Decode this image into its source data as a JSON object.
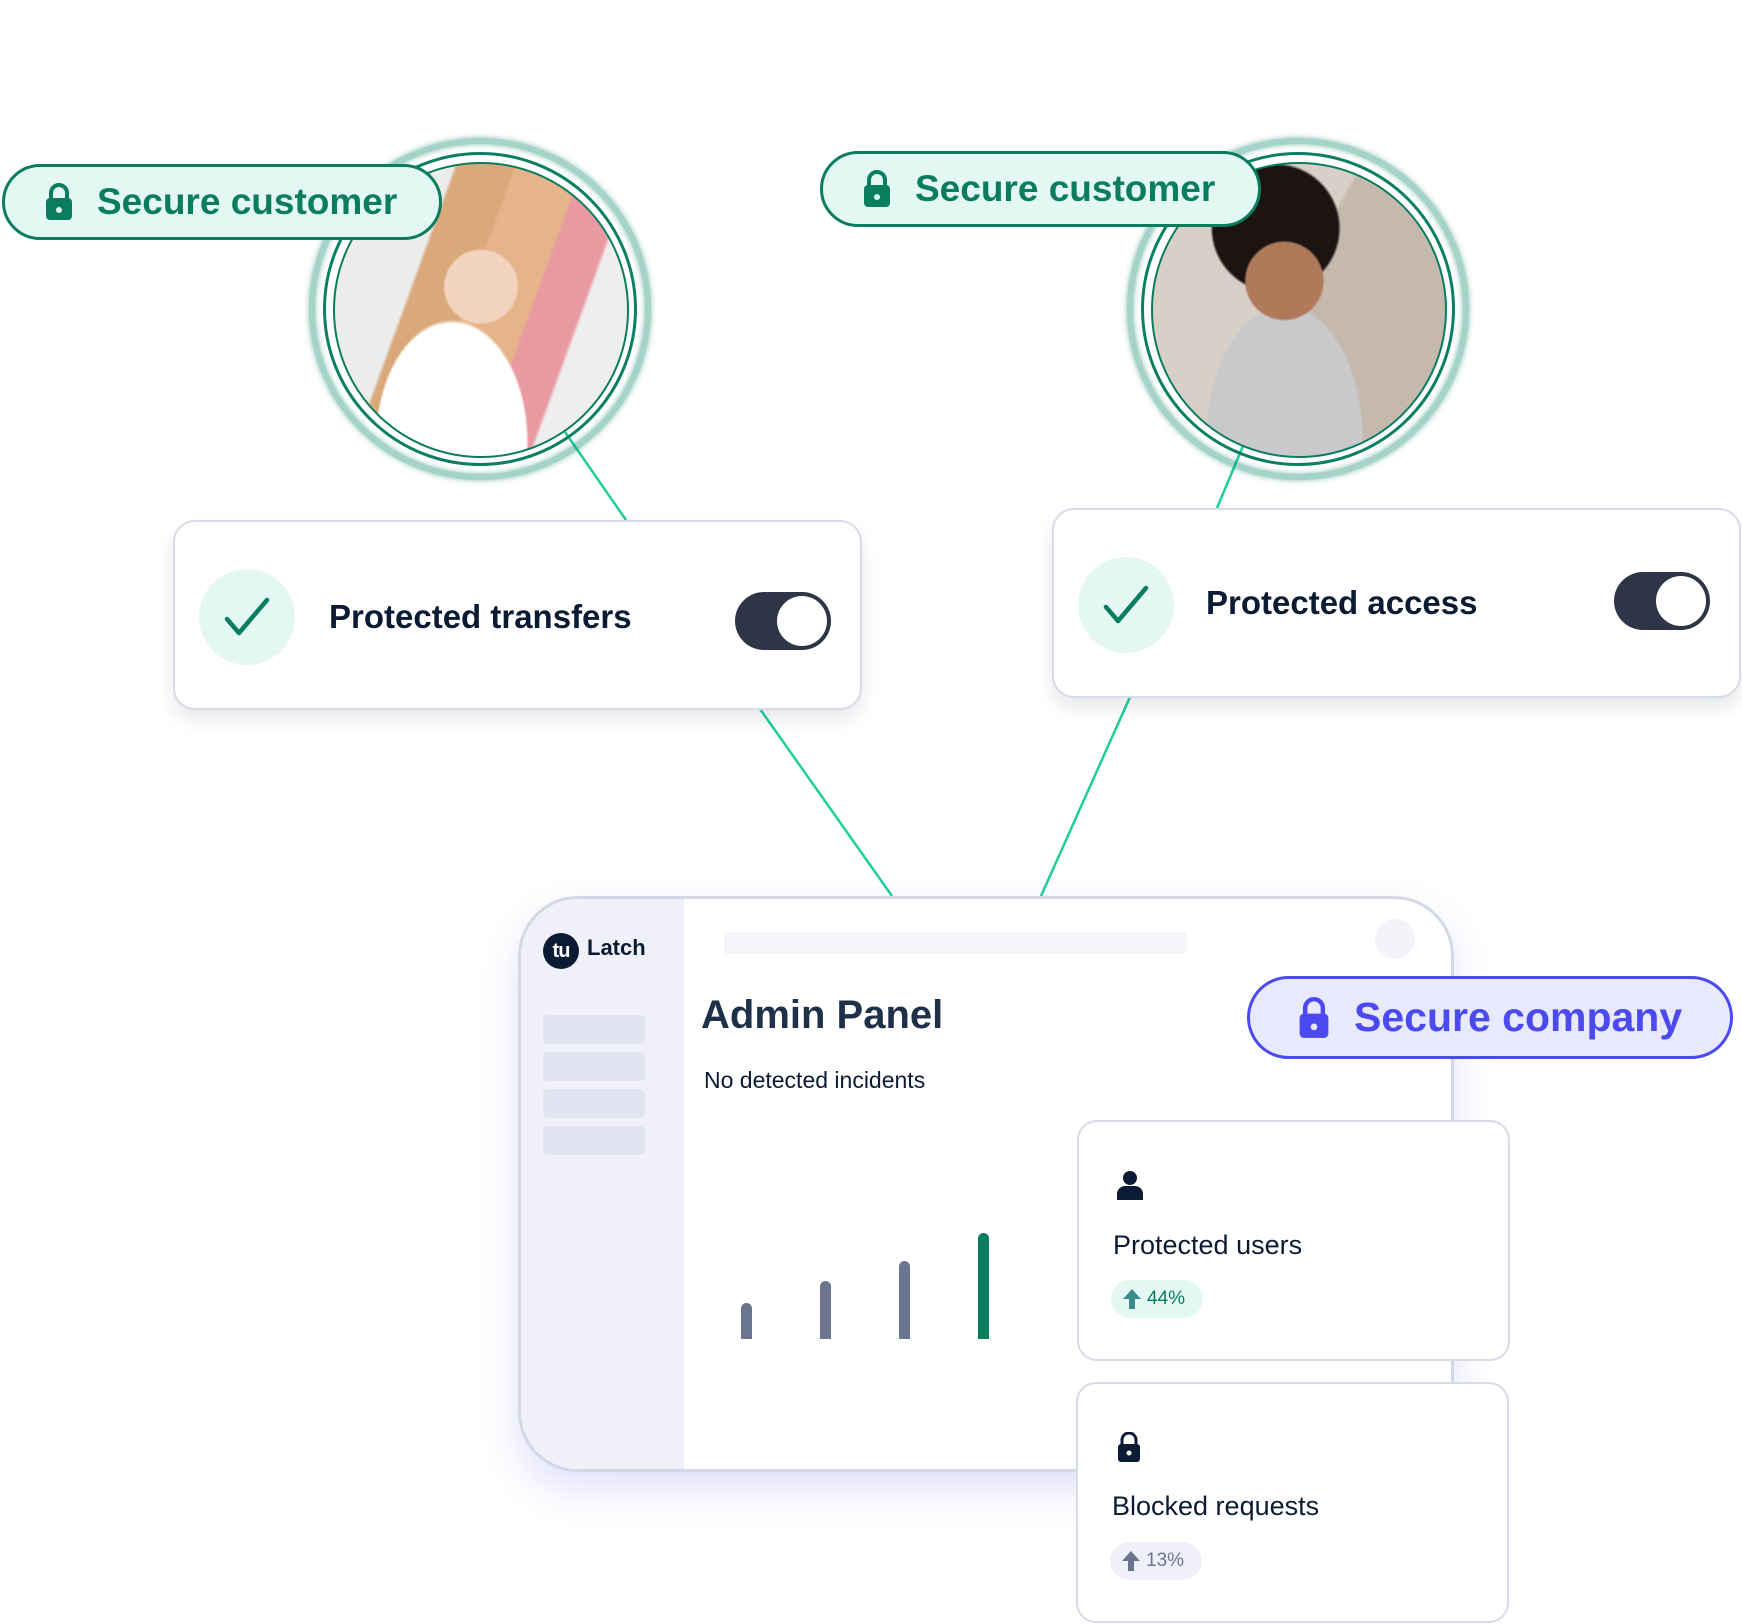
{
  "customers": [
    {
      "badge_label": "Secure customer",
      "badge_icon": "lock-icon",
      "photo_desc": "smiling woman with pink-tipped blonde hair"
    },
    {
      "badge_label": "Secure customer",
      "badge_icon": "lock-icon",
      "photo_desc": "smiling woman on phone"
    }
  ],
  "protections": [
    {
      "label": "Protected transfers",
      "icon": "check-icon",
      "toggle_on": true
    },
    {
      "label": "Protected access",
      "icon": "check-icon",
      "toggle_on": true
    }
  ],
  "company_badge": {
    "label": "Secure company",
    "icon": "lock-icon"
  },
  "admin_panel": {
    "logo_mark": "tu",
    "logo_text": "Latch",
    "title": "Admin Panel",
    "subtitle": "No detected incidents"
  },
  "stats": [
    {
      "icon": "user-icon",
      "title": "Protected users",
      "change": "44%",
      "trend": "up",
      "color": "#0a7d5e"
    },
    {
      "icon": "lock-icon",
      "title": "Blocked requests",
      "change": "13%",
      "trend": "up",
      "color": "#6c7590"
    }
  ],
  "colors": {
    "accent_green": "#0a7d5e",
    "connector_green": "#1ecf98",
    "accent_blue": "#4a4af0",
    "bar_gray": "#6c7590",
    "dark": "#0b1b33"
  },
  "chart_data": {
    "type": "bar",
    "categories": [
      "1",
      "2",
      "3",
      "4"
    ],
    "values": [
      30,
      48,
      65,
      88
    ],
    "highlight_index": 3,
    "title": "",
    "xlabel": "",
    "ylabel": "",
    "ylim": [
      0,
      100
    ]
  }
}
